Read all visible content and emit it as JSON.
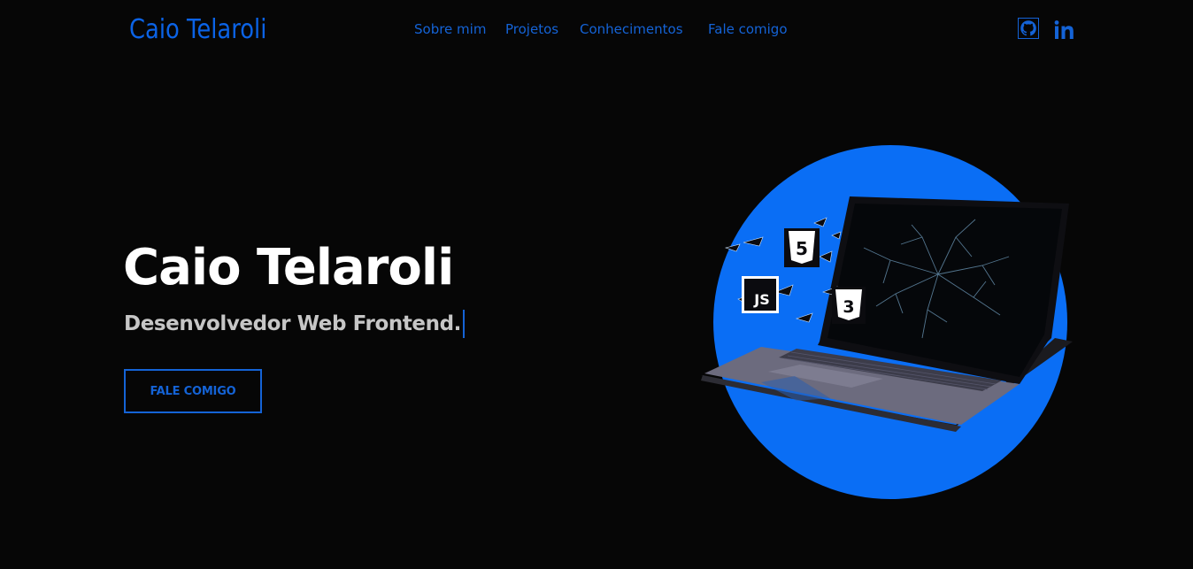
{
  "header": {
    "brand": "Caio Telaroli",
    "nav": [
      {
        "label": "Sobre mim"
      },
      {
        "label": "Projetos"
      },
      {
        "label": "Conhecimentos"
      },
      {
        "label": "Fale comigo"
      }
    ],
    "social": [
      {
        "icon": "github-icon"
      },
      {
        "icon": "linkedin-icon"
      }
    ]
  },
  "hero": {
    "title": "Caio Telaroli",
    "subtitle": "Desenvolvedor Web Frontend.",
    "cta_label": "FALE COMIGO",
    "illustration": {
      "icons": [
        "html5-icon",
        "javascript-icon",
        "css3-icon"
      ],
      "badges": {
        "html": "5",
        "js": "JS",
        "css": "3"
      }
    }
  },
  "colors": {
    "background": "#060606",
    "accent": "#1463d6",
    "circle": "#0a6ef5",
    "title": "#ffffff",
    "subtitle": "#c6c6c6"
  }
}
